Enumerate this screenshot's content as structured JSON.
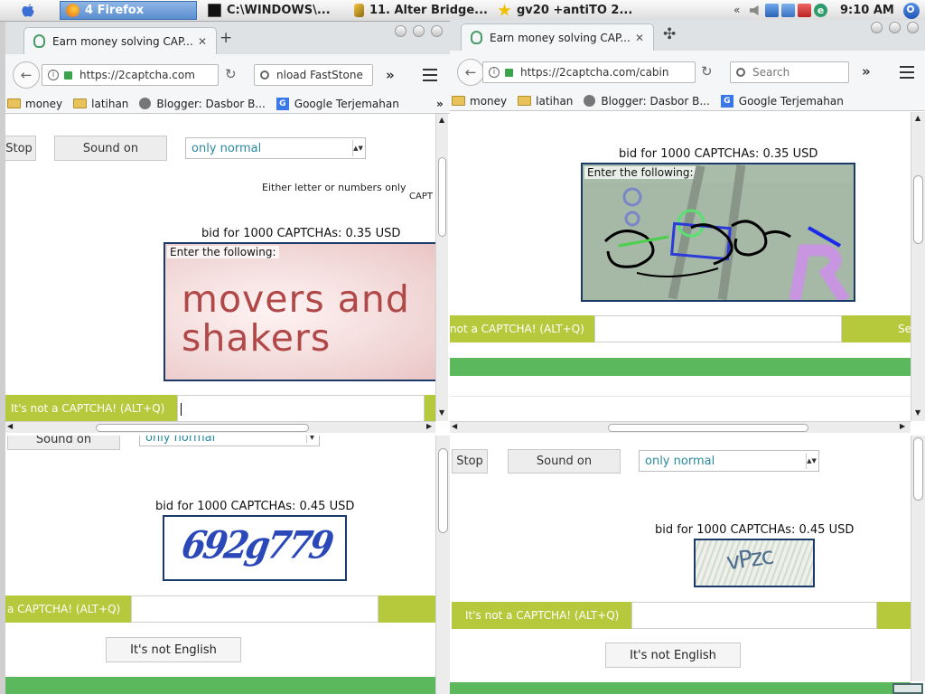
{
  "taskbar": {
    "items": [
      {
        "label": "4 Firefox"
      },
      {
        "label": "C:\\WINDOWS\\..."
      },
      {
        "label": "11. Alter Bridge..."
      },
      {
        "label": "gv20 +antiTO 2..."
      }
    ],
    "clock": "9:10 AM"
  },
  "win_left_top": {
    "tab_title": "Earn money solving CAP...",
    "url": "https://2captcha.com",
    "search": "nload FastStone",
    "bookmarks": [
      "money",
      "latihan",
      "Blogger: Dasbor B...",
      "Google Terjemahan"
    ],
    "stop": "Stop",
    "sound": "Sound on",
    "mode": "only normal",
    "hint": "Either letter or numbers only",
    "capt_cut": "CAPT",
    "bid": "bid for 1000 CAPTCHAs: 0.35 USD",
    "enter": "Enter the following:",
    "captcha_line1": "movers and",
    "captcha_line2": "shakers",
    "not_captcha": "It's not a CAPTCHA! (ALT+Q)"
  },
  "win_right_top": {
    "tab_title": "Earn money solving CAP...",
    "url": "https://2captcha.com/cabin",
    "search_placeholder": "Search",
    "bookmarks": [
      "money",
      "latihan",
      "Blogger: Dasbor B...",
      "Google Terjemahan"
    ],
    "bid": "bid for 1000 CAPTCHAs: 0.35 USD",
    "enter": "Enter the following:",
    "not_captcha": "not a CAPTCHA! (ALT+Q)",
    "send_cut": "Se"
  },
  "win_left_bottom": {
    "sound": "Sound on",
    "mode": "only normal",
    "bid": "bid for 1000 CAPTCHAs: 0.45 USD",
    "captcha_text": "692g779",
    "not_captcha": "a CAPTCHA! (ALT+Q)",
    "not_english": "It's not English"
  },
  "win_right_bottom": {
    "stop": "Stop",
    "sound": "Sound on",
    "mode": "only normal",
    "bid": "bid for 1000 CAPTCHAs: 0.45 USD",
    "captcha_text": "vPzc",
    "not_captcha": "It's not a CAPTCHA! (ALT+Q)",
    "not_english": "It's not English"
  },
  "colors": {
    "green": "#b6c93c",
    "band": "#5cb85c",
    "captcha_border": "#1a3a6a"
  }
}
